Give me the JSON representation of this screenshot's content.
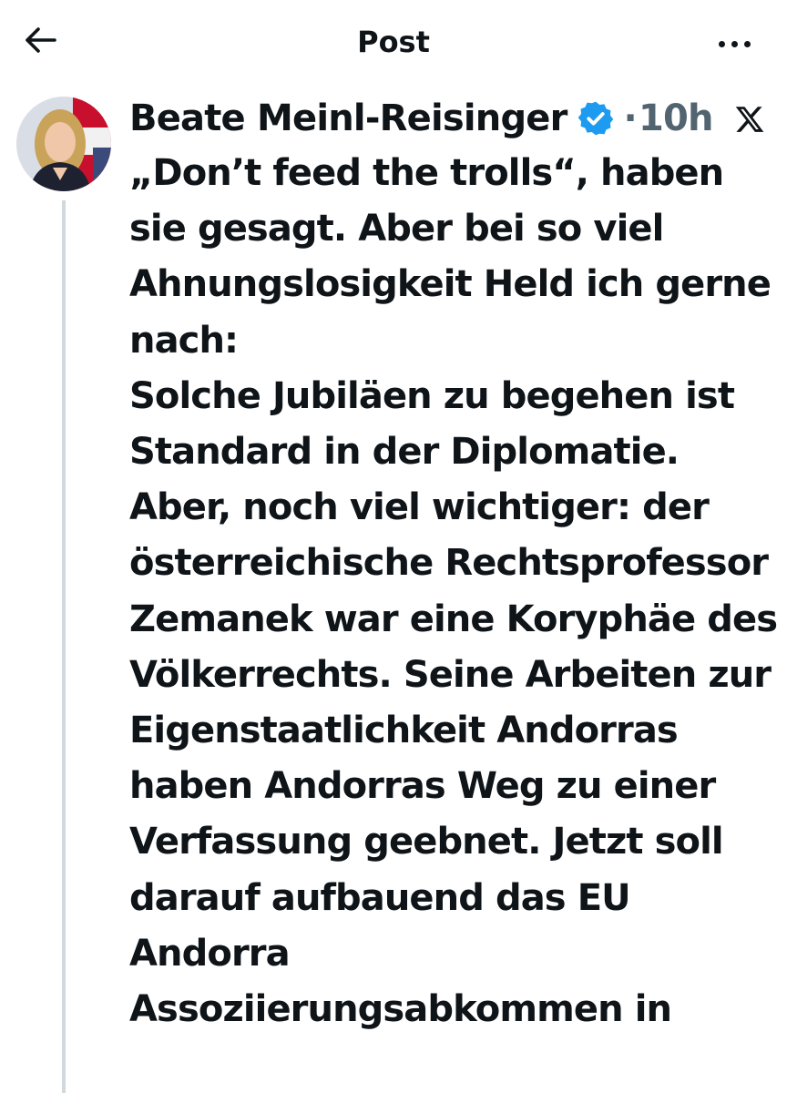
{
  "header": {
    "title": "Post",
    "back_icon": "arrow-left-icon",
    "more_icon": "more-horizontal-icon"
  },
  "post": {
    "author": "Beate Meinl-Reisinger",
    "verified_icon": "verified-badge-icon",
    "separator": "·",
    "time": "10h",
    "source_icon": "x-logo-icon",
    "text": "„Don’t feed the trolls“, haben sie gesagt. Aber bei so viel Ahnungslosigkeit Held ich gerne nach:\nSolche Jubiläen zu begehen ist Standard in der Diplomatie. Aber, noch viel wichtiger: der österreichische Rechtsprofessor Zemanek war eine Koryphäe des Völkerrechts. Seine Arbeiten zur Eigenstaatlichkeit Andorras haben Andorras Weg zu einer Verfassung geebnet. Jetzt soll darauf aufbauend das EU Andorra Assoziierungsabkommen in"
  },
  "colors": {
    "text": "#0f1419",
    "secondary": "#536471",
    "verified": "#1d9bf0",
    "thread_line": "#cfd9de"
  }
}
